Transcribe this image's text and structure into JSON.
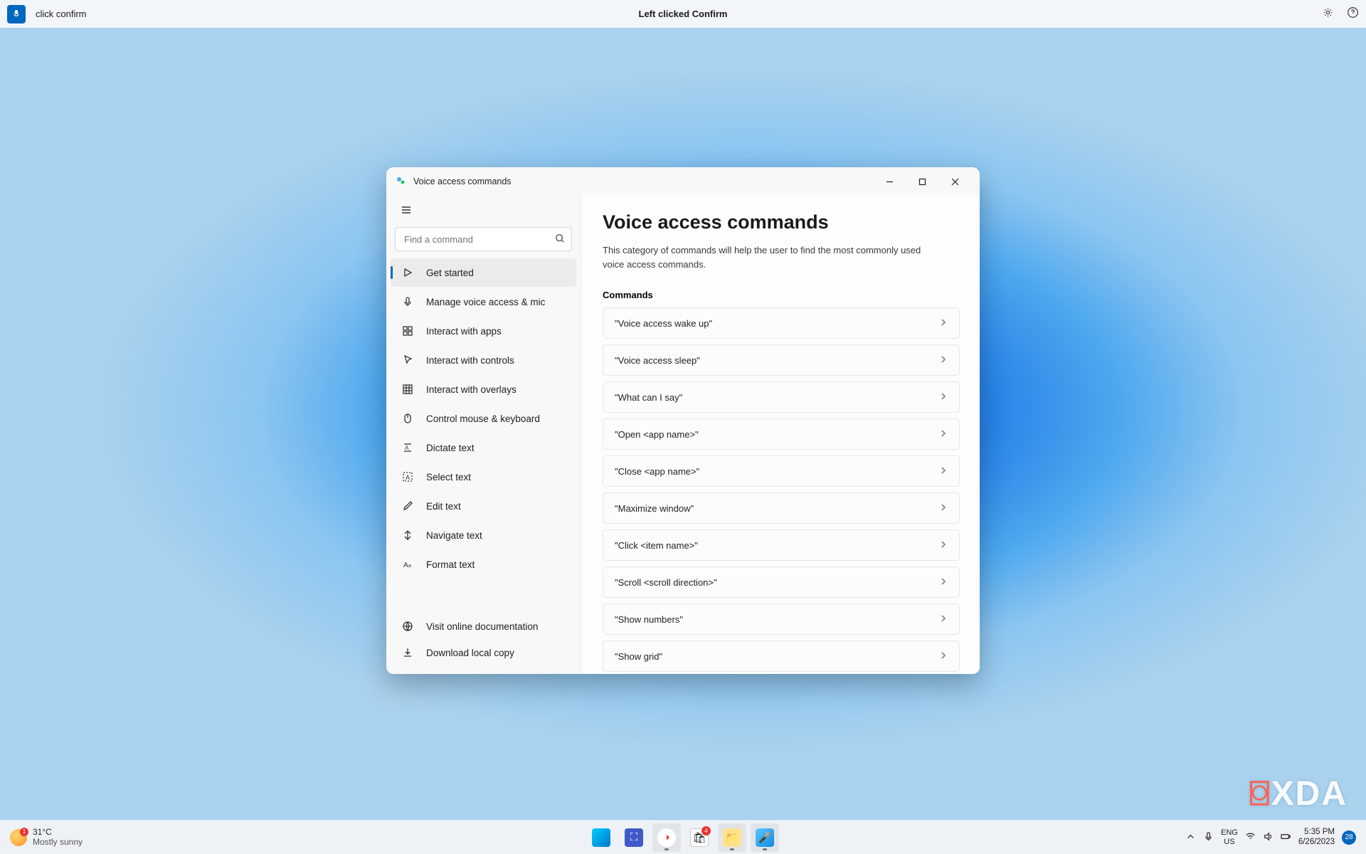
{
  "voice_bar": {
    "command": "click confirm",
    "status": "Left clicked Confirm"
  },
  "window": {
    "title": "Voice access commands",
    "search_placeholder": "Find a command",
    "nav": [
      {
        "label": "Get started",
        "icon": "play",
        "selected": true
      },
      {
        "label": "Manage voice access & mic",
        "icon": "mic"
      },
      {
        "label": "Interact with apps",
        "icon": "apps"
      },
      {
        "label": "Interact with controls",
        "icon": "cursor"
      },
      {
        "label": "Interact with overlays",
        "icon": "grid"
      },
      {
        "label": "Control mouse & keyboard",
        "icon": "mouse"
      },
      {
        "label": "Dictate text",
        "icon": "dictate"
      },
      {
        "label": "Select text",
        "icon": "select"
      },
      {
        "label": "Edit text",
        "icon": "edit"
      },
      {
        "label": "Navigate text",
        "icon": "nav"
      },
      {
        "label": "Format text",
        "icon": "format"
      }
    ],
    "nav_bottom": [
      {
        "label": "Visit online documentation",
        "icon": "globe"
      },
      {
        "label": "Download local copy",
        "icon": "download"
      }
    ],
    "main": {
      "heading": "Voice access commands",
      "description": "This category of commands will help the user to find the most commonly used voice access commands.",
      "commands_label": "Commands",
      "commands": [
        "\"Voice access wake up\"",
        "\"Voice access sleep\"",
        "\"What can I say\"",
        "\"Open <app name>\"",
        "\"Close <app name>\"",
        "\"Maximize window\"",
        "\"Click <item name>\"",
        "\"Scroll <scroll direction>\"",
        "\"Show numbers\"",
        "\"Show grid\""
      ]
    }
  },
  "taskbar": {
    "weather_temp": "31°C",
    "weather_desc": "Mostly sunny",
    "lang1": "ENG",
    "lang2": "US",
    "time": "5:35 PM",
    "date": "6/26/2023",
    "notif": "28"
  },
  "watermark": "XDA"
}
